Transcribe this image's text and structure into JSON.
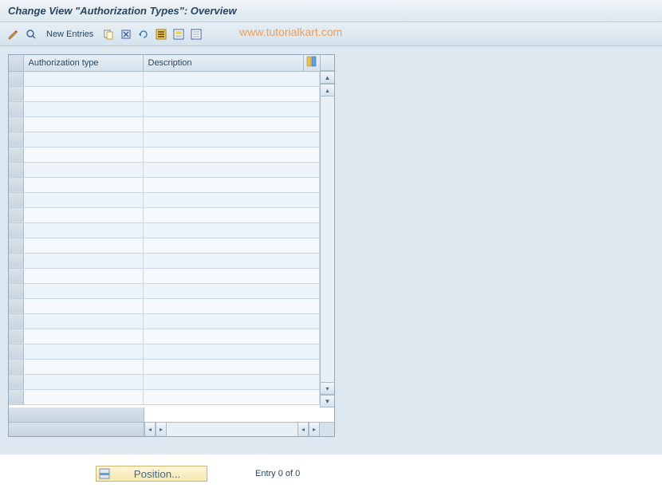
{
  "title": "Change View \"Authorization Types\": Overview",
  "toolbar": {
    "new_entries_label": "New Entries"
  },
  "watermark": "www.tutorialkart.com",
  "table": {
    "columns": {
      "auth_type": "Authorization type",
      "description": "Description"
    },
    "rows": 22
  },
  "footer": {
    "position_label": "Position...",
    "entry_text": "Entry 0 of 0"
  }
}
